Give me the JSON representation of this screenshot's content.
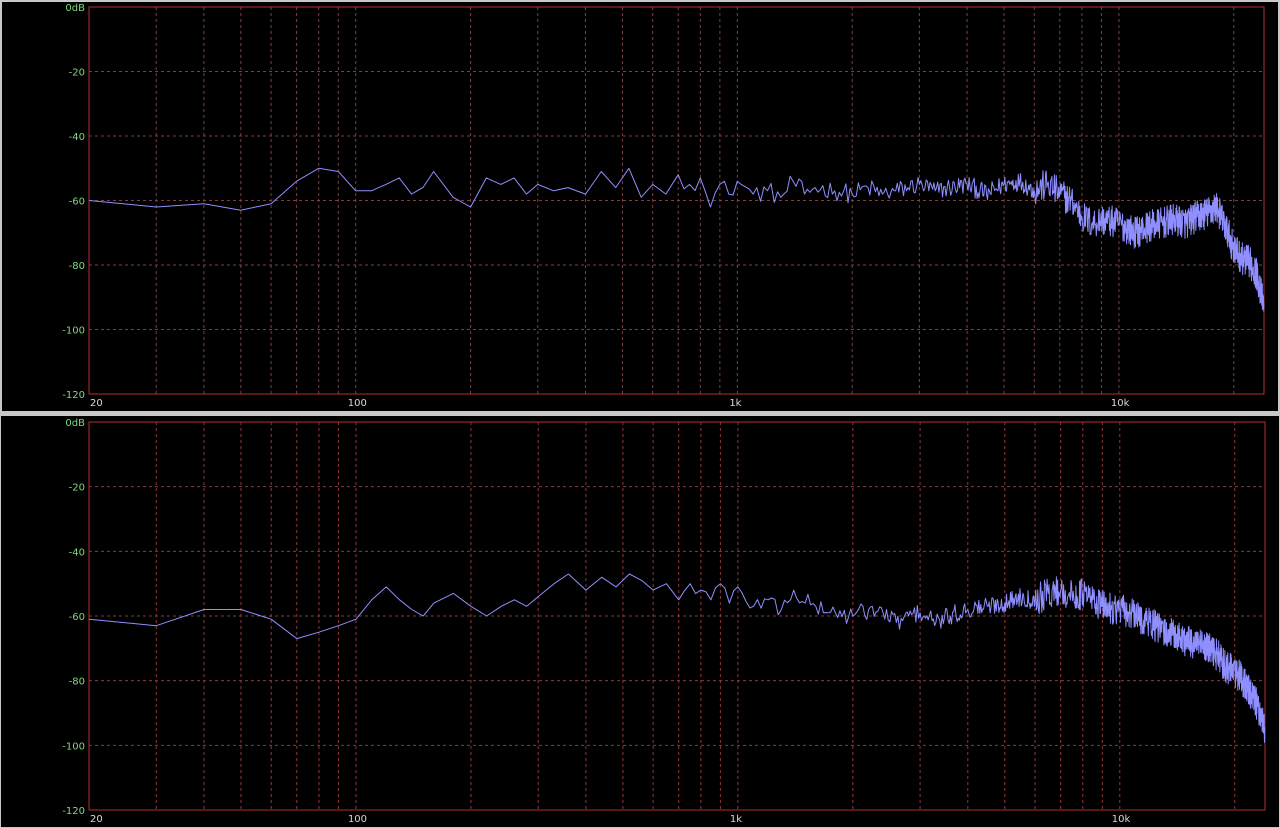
{
  "colors": {
    "background": "#000000",
    "frame": "#b03030",
    "grid": "#8a3a3a",
    "trace": "#8f8fff",
    "y_tick_text": "#7fd77f",
    "x_tick_text": "#d8d8d8"
  },
  "chart_data": [
    {
      "type": "line",
      "name": "",
      "xscale": "log",
      "xlim": [
        20,
        24000
      ],
      "ylim": [
        -120,
        0
      ],
      "grid": true,
      "y_ticks": [
        {
          "value": 0,
          "label": "0dB"
        },
        {
          "value": -20,
          "label": "-20"
        },
        {
          "value": -40,
          "label": "-40"
        },
        {
          "value": -60,
          "label": "-60"
        },
        {
          "value": -80,
          "label": "-80"
        },
        {
          "value": -100,
          "label": "-100"
        },
        {
          "value": -120,
          "label": "-120"
        }
      ],
      "x_ticks": [
        {
          "value": 20,
          "label": "20"
        },
        {
          "value": 100,
          "label": "100"
        },
        {
          "value": 1000,
          "label": "1k"
        },
        {
          "value": 10000,
          "label": "10k"
        }
      ],
      "series": [
        {
          "x": [
            20,
            30,
            40,
            50,
            60,
            70,
            80,
            90,
            100,
            110,
            120,
            130,
            140,
            150,
            160,
            180,
            200,
            220,
            240,
            260,
            280,
            300,
            330,
            360,
            400,
            440,
            480,
            520,
            560,
            600,
            650,
            700,
            750,
            800,
            850,
            900,
            950,
            1000,
            1100,
            1200,
            1300,
            1400,
            1500,
            1600,
            1800,
            2000,
            2200,
            2400,
            2600,
            2800,
            3000,
            3300,
            3600,
            4000,
            4500,
            5000,
            5500,
            6000,
            6500,
            7000,
            7500,
            8000,
            8500,
            9000,
            10000,
            11000,
            12000,
            13000,
            14000,
            15000,
            16000,
            17000,
            18000,
            19000,
            20000,
            21000,
            22000,
            23000,
            24000
          ],
          "y": [
            -60,
            -62,
            -61,
            -63,
            -61,
            -54,
            -50,
            -51,
            -57,
            -57,
            -55,
            -53,
            -58,
            -56,
            -51,
            -59,
            -62,
            -53,
            -55,
            -53,
            -58,
            -55,
            -57,
            -56,
            -58,
            -51,
            -56,
            -50,
            -59,
            -55,
            -58,
            -52,
            -55,
            -53,
            -62,
            -55,
            -58,
            -54,
            -58,
            -57,
            -59,
            -54,
            -58,
            -56,
            -57,
            -58,
            -56,
            -58,
            -57,
            -56,
            -55,
            -57,
            -56,
            -55,
            -58,
            -55,
            -54,
            -57,
            -55,
            -58,
            -60,
            -65,
            -67,
            -66,
            -67,
            -70,
            -68,
            -67,
            -66,
            -67,
            -65,
            -64,
            -62,
            -68,
            -75,
            -78,
            -79,
            -83,
            -93
          ]
        }
      ]
    },
    {
      "type": "line",
      "name": "",
      "xscale": "log",
      "xlim": [
        20,
        24000
      ],
      "ylim": [
        -120,
        0
      ],
      "grid": true,
      "y_ticks": [
        {
          "value": 0,
          "label": "0dB"
        },
        {
          "value": -20,
          "label": "-20"
        },
        {
          "value": -40,
          "label": "-40"
        },
        {
          "value": -60,
          "label": "-60"
        },
        {
          "value": -80,
          "label": "-80"
        },
        {
          "value": -100,
          "label": "-100"
        },
        {
          "value": -120,
          "label": "-120"
        }
      ],
      "x_ticks": [
        {
          "value": 20,
          "label": "20"
        },
        {
          "value": 100,
          "label": "100"
        },
        {
          "value": 1000,
          "label": "1k"
        },
        {
          "value": 10000,
          "label": "10k"
        }
      ],
      "series": [
        {
          "x": [
            20,
            30,
            40,
            50,
            60,
            70,
            80,
            90,
            100,
            110,
            120,
            130,
            140,
            150,
            160,
            180,
            200,
            220,
            240,
            260,
            280,
            300,
            330,
            360,
            400,
            440,
            480,
            520,
            560,
            600,
            650,
            700,
            750,
            800,
            850,
            900,
            950,
            1000,
            1100,
            1200,
            1300,
            1400,
            1500,
            1600,
            1800,
            2000,
            2200,
            2400,
            2600,
            2800,
            3000,
            3300,
            3600,
            4000,
            4500,
            5000,
            5500,
            6000,
            6500,
            7000,
            7500,
            8000,
            8500,
            9000,
            10000,
            11000,
            12000,
            13000,
            14000,
            15000,
            16000,
            17000,
            18000,
            19000,
            20000,
            21000,
            22000,
            23000,
            24000
          ],
          "y": [
            -61,
            -63,
            -58,
            -58,
            -61,
            -67,
            -65,
            -63,
            -61,
            -55,
            -51,
            -55,
            -58,
            -60,
            -56,
            -53,
            -57,
            -60,
            -57,
            -55,
            -57,
            -54,
            -50,
            -47,
            -52,
            -48,
            -51,
            -47,
            -49,
            -52,
            -50,
            -55,
            -50,
            -52,
            -55,
            -50,
            -56,
            -51,
            -57,
            -55,
            -58,
            -52,
            -56,
            -57,
            -59,
            -60,
            -58,
            -59,
            -62,
            -60,
            -59,
            -62,
            -60,
            -58,
            -57,
            -56,
            -54,
            -55,
            -53,
            -52,
            -54,
            -53,
            -55,
            -57,
            -58,
            -60,
            -62,
            -65,
            -66,
            -68,
            -69,
            -70,
            -72,
            -76,
            -77,
            -80,
            -84,
            -88,
            -95
          ]
        }
      ]
    }
  ]
}
